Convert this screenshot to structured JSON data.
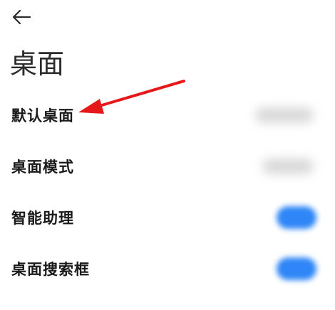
{
  "header": {
    "back_icon": "arrow-left-icon",
    "title": "桌面"
  },
  "settings": {
    "items": [
      {
        "label": "默认桌面",
        "control": "value"
      },
      {
        "label": "桌面模式",
        "control": "value"
      },
      {
        "label": "智能助理",
        "control": "toggle",
        "enabled": true
      },
      {
        "label": "桌面搜索框",
        "control": "toggle",
        "enabled": true
      }
    ]
  },
  "colors": {
    "toggle_on": "#2f86f6",
    "annotation_arrow": "#e5191a"
  }
}
